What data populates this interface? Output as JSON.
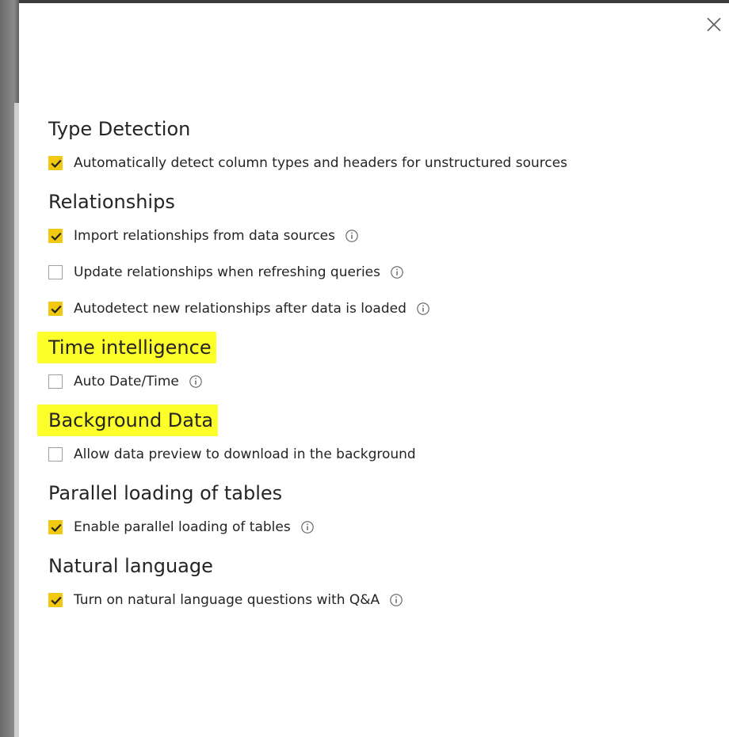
{
  "dialog": {
    "close_icon": "close-icon",
    "sections": [
      {
        "title": "Type Detection",
        "highlighted": false,
        "options": [
          {
            "label": "Automatically detect column types and headers for unstructured sources",
            "checked": true,
            "info": false
          }
        ]
      },
      {
        "title": "Relationships",
        "highlighted": false,
        "options": [
          {
            "label": "Import relationships from data sources",
            "checked": true,
            "info": true
          },
          {
            "label": "Update relationships when refreshing queries",
            "checked": false,
            "info": true
          },
          {
            "label": "Autodetect new relationships after data is loaded",
            "checked": true,
            "info": true
          }
        ]
      },
      {
        "title": "Time intelligence",
        "highlighted": true,
        "options": [
          {
            "label": "Auto Date/Time",
            "checked": false,
            "info": true
          }
        ]
      },
      {
        "title": "Background Data",
        "highlighted": true,
        "options": [
          {
            "label": "Allow data preview to download in the background",
            "checked": false,
            "info": false
          }
        ]
      },
      {
        "title": "Parallel loading of tables",
        "highlighted": false,
        "options": [
          {
            "label": "Enable parallel loading of tables",
            "checked": true,
            "info": true
          }
        ]
      },
      {
        "title": "Natural language",
        "highlighted": false,
        "options": [
          {
            "label": "Turn on natural language questions with Q&A",
            "checked": true,
            "info": true
          }
        ]
      }
    ]
  },
  "colors": {
    "checkbox_checked": "#f2c811",
    "highlight": "#fcff2a",
    "text": "#252423",
    "info_icon": "#605e5c"
  }
}
